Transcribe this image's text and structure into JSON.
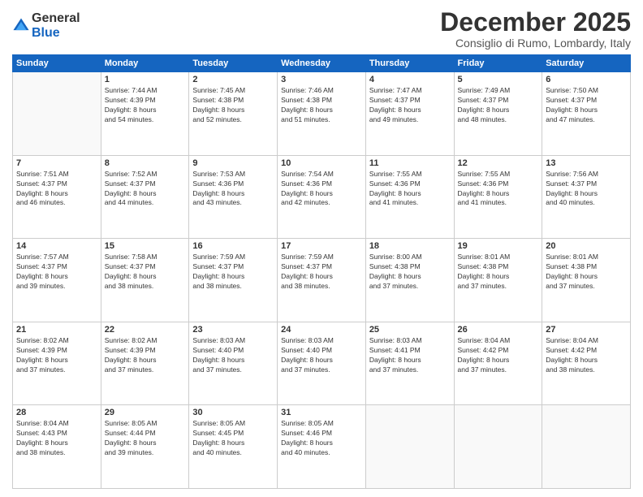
{
  "logo": {
    "general": "General",
    "blue": "Blue"
  },
  "header": {
    "month_year": "December 2025",
    "location": "Consiglio di Rumo, Lombardy, Italy"
  },
  "weekdays": [
    "Sunday",
    "Monday",
    "Tuesday",
    "Wednesday",
    "Thursday",
    "Friday",
    "Saturday"
  ],
  "weeks": [
    [
      {
        "day": "",
        "info": ""
      },
      {
        "day": "1",
        "info": "Sunrise: 7:44 AM\nSunset: 4:39 PM\nDaylight: 8 hours\nand 54 minutes."
      },
      {
        "day": "2",
        "info": "Sunrise: 7:45 AM\nSunset: 4:38 PM\nDaylight: 8 hours\nand 52 minutes."
      },
      {
        "day": "3",
        "info": "Sunrise: 7:46 AM\nSunset: 4:38 PM\nDaylight: 8 hours\nand 51 minutes."
      },
      {
        "day": "4",
        "info": "Sunrise: 7:47 AM\nSunset: 4:37 PM\nDaylight: 8 hours\nand 49 minutes."
      },
      {
        "day": "5",
        "info": "Sunrise: 7:49 AM\nSunset: 4:37 PM\nDaylight: 8 hours\nand 48 minutes."
      },
      {
        "day": "6",
        "info": "Sunrise: 7:50 AM\nSunset: 4:37 PM\nDaylight: 8 hours\nand 47 minutes."
      }
    ],
    [
      {
        "day": "7",
        "info": "Sunrise: 7:51 AM\nSunset: 4:37 PM\nDaylight: 8 hours\nand 46 minutes."
      },
      {
        "day": "8",
        "info": "Sunrise: 7:52 AM\nSunset: 4:37 PM\nDaylight: 8 hours\nand 44 minutes."
      },
      {
        "day": "9",
        "info": "Sunrise: 7:53 AM\nSunset: 4:36 PM\nDaylight: 8 hours\nand 43 minutes."
      },
      {
        "day": "10",
        "info": "Sunrise: 7:54 AM\nSunset: 4:36 PM\nDaylight: 8 hours\nand 42 minutes."
      },
      {
        "day": "11",
        "info": "Sunrise: 7:55 AM\nSunset: 4:36 PM\nDaylight: 8 hours\nand 41 minutes."
      },
      {
        "day": "12",
        "info": "Sunrise: 7:55 AM\nSunset: 4:36 PM\nDaylight: 8 hours\nand 41 minutes."
      },
      {
        "day": "13",
        "info": "Sunrise: 7:56 AM\nSunset: 4:37 PM\nDaylight: 8 hours\nand 40 minutes."
      }
    ],
    [
      {
        "day": "14",
        "info": "Sunrise: 7:57 AM\nSunset: 4:37 PM\nDaylight: 8 hours\nand 39 minutes."
      },
      {
        "day": "15",
        "info": "Sunrise: 7:58 AM\nSunset: 4:37 PM\nDaylight: 8 hours\nand 38 minutes."
      },
      {
        "day": "16",
        "info": "Sunrise: 7:59 AM\nSunset: 4:37 PM\nDaylight: 8 hours\nand 38 minutes."
      },
      {
        "day": "17",
        "info": "Sunrise: 7:59 AM\nSunset: 4:37 PM\nDaylight: 8 hours\nand 38 minutes."
      },
      {
        "day": "18",
        "info": "Sunrise: 8:00 AM\nSunset: 4:38 PM\nDaylight: 8 hours\nand 37 minutes."
      },
      {
        "day": "19",
        "info": "Sunrise: 8:01 AM\nSunset: 4:38 PM\nDaylight: 8 hours\nand 37 minutes."
      },
      {
        "day": "20",
        "info": "Sunrise: 8:01 AM\nSunset: 4:38 PM\nDaylight: 8 hours\nand 37 minutes."
      }
    ],
    [
      {
        "day": "21",
        "info": "Sunrise: 8:02 AM\nSunset: 4:39 PM\nDaylight: 8 hours\nand 37 minutes."
      },
      {
        "day": "22",
        "info": "Sunrise: 8:02 AM\nSunset: 4:39 PM\nDaylight: 8 hours\nand 37 minutes."
      },
      {
        "day": "23",
        "info": "Sunrise: 8:03 AM\nSunset: 4:40 PM\nDaylight: 8 hours\nand 37 minutes."
      },
      {
        "day": "24",
        "info": "Sunrise: 8:03 AM\nSunset: 4:40 PM\nDaylight: 8 hours\nand 37 minutes."
      },
      {
        "day": "25",
        "info": "Sunrise: 8:03 AM\nSunset: 4:41 PM\nDaylight: 8 hours\nand 37 minutes."
      },
      {
        "day": "26",
        "info": "Sunrise: 8:04 AM\nSunset: 4:42 PM\nDaylight: 8 hours\nand 37 minutes."
      },
      {
        "day": "27",
        "info": "Sunrise: 8:04 AM\nSunset: 4:42 PM\nDaylight: 8 hours\nand 38 minutes."
      }
    ],
    [
      {
        "day": "28",
        "info": "Sunrise: 8:04 AM\nSunset: 4:43 PM\nDaylight: 8 hours\nand 38 minutes."
      },
      {
        "day": "29",
        "info": "Sunrise: 8:05 AM\nSunset: 4:44 PM\nDaylight: 8 hours\nand 39 minutes."
      },
      {
        "day": "30",
        "info": "Sunrise: 8:05 AM\nSunset: 4:45 PM\nDaylight: 8 hours\nand 40 minutes."
      },
      {
        "day": "31",
        "info": "Sunrise: 8:05 AM\nSunset: 4:46 PM\nDaylight: 8 hours\nand 40 minutes."
      },
      {
        "day": "",
        "info": ""
      },
      {
        "day": "",
        "info": ""
      },
      {
        "day": "",
        "info": ""
      }
    ]
  ]
}
